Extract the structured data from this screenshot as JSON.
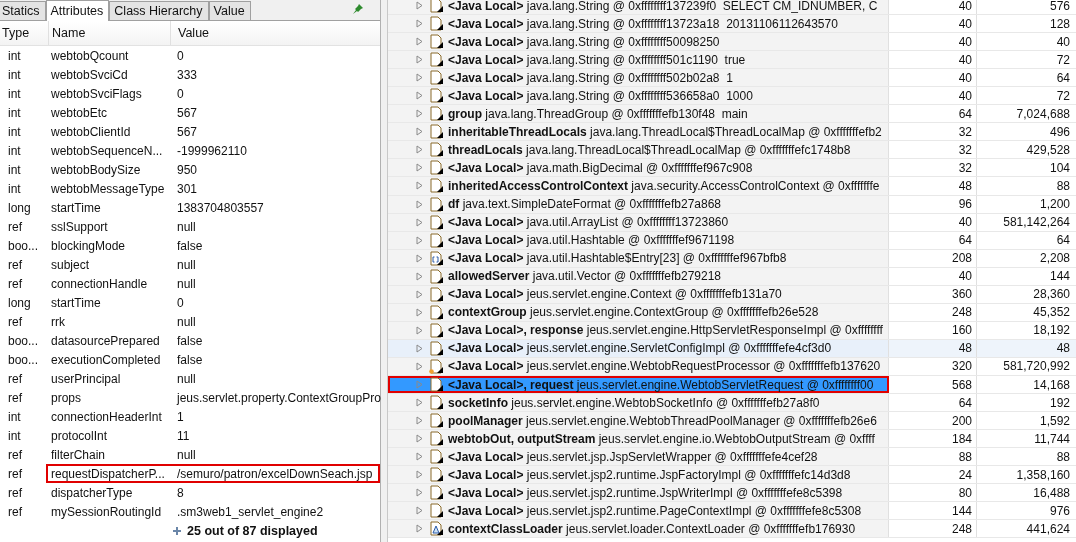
{
  "left_panel": {
    "tabs": [
      {
        "label": "Statics",
        "selected": false
      },
      {
        "label": "Attributes",
        "selected": true
      },
      {
        "label": "Class Hierarchy",
        "selected": false
      },
      {
        "label": "Value",
        "selected": false
      }
    ],
    "columns": [
      "Type",
      "Name",
      "Value"
    ],
    "rows": [
      {
        "type": "int",
        "name": "webtobQcount",
        "value": "0",
        "highlighted": false
      },
      {
        "type": "int",
        "name": "webtobSvciCd",
        "value": "333",
        "highlighted": false
      },
      {
        "type": "int",
        "name": "webtobSvciFlags",
        "value": "0",
        "highlighted": false
      },
      {
        "type": "int",
        "name": "webtobEtc",
        "value": "567",
        "highlighted": false
      },
      {
        "type": "int",
        "name": "webtobClientId",
        "value": "567",
        "highlighted": false
      },
      {
        "type": "int",
        "name": "webtobSequenceN...",
        "value": "-1999962110",
        "highlighted": false
      },
      {
        "type": "int",
        "name": "webtobBodySize",
        "value": "950",
        "highlighted": false
      },
      {
        "type": "int",
        "name": "webtobMessageType",
        "value": "301",
        "highlighted": false
      },
      {
        "type": "long",
        "name": "startTime",
        "value": "1383704803557",
        "highlighted": false
      },
      {
        "type": "ref",
        "name": "sslSupport",
        "value": "null",
        "highlighted": false
      },
      {
        "type": "boo...",
        "name": "blockingMode",
        "value": "false",
        "highlighted": false
      },
      {
        "type": "ref",
        "name": "subject",
        "value": "null",
        "highlighted": false
      },
      {
        "type": "ref",
        "name": "connectionHandle",
        "value": "null",
        "highlighted": false
      },
      {
        "type": "long",
        "name": "startTime",
        "value": "0",
        "highlighted": false
      },
      {
        "type": "ref",
        "name": "rrk",
        "value": "null",
        "highlighted": false
      },
      {
        "type": "boo...",
        "name": "datasourcePrepared",
        "value": "false",
        "highlighted": false
      },
      {
        "type": "boo...",
        "name": "executionCompleted",
        "value": "false",
        "highlighted": false
      },
      {
        "type": "ref",
        "name": "userPrincipal",
        "value": "null",
        "highlighted": false
      },
      {
        "type": "ref",
        "name": "props",
        "value": "jeus.servlet.property.ContextGroupPro",
        "highlighted": false
      },
      {
        "type": "int",
        "name": "connectionHeaderInt",
        "value": "1",
        "highlighted": false
      },
      {
        "type": "int",
        "name": "protocolInt",
        "value": "11",
        "highlighted": false
      },
      {
        "type": "ref",
        "name": "filterChain",
        "value": "null",
        "highlighted": false
      },
      {
        "type": "ref",
        "name": "requestDispatcherP...",
        "value": "/semuro/patron/excelDownSeach.jsp",
        "highlighted": true
      },
      {
        "type": "ref",
        "name": "dispatcherType",
        "value": "8",
        "highlighted": false
      },
      {
        "type": "ref",
        "name": "mySessionRoutingId",
        "value": ".sm3web1_servlet_engine2",
        "highlighted": false
      }
    ],
    "footer": "25 out of 87 displayed"
  },
  "tree": {
    "rows": [
      {
        "kind": "object",
        "text": "**<Java Local>** java.lang.String @ 0xffffffff137239f0  SELECT CM_IDNUMBER, C",
        "shallow": "40",
        "retained": "576",
        "selected": false,
        "highlighted": false,
        "hovered": false
      },
      {
        "kind": "object",
        "text": "**<Java Local>** java.lang.String @ 0xffffffff13723a18  20131106112643570",
        "shallow": "40",
        "retained": "128",
        "selected": false,
        "highlighted": false,
        "hovered": false
      },
      {
        "kind": "object",
        "text": "**<Java Local>** java.lang.String @ 0xffffffff50098250",
        "shallow": "40",
        "retained": "40",
        "selected": false,
        "highlighted": false,
        "hovered": false
      },
      {
        "kind": "object",
        "text": "**<Java Local>** java.lang.String @ 0xffffffff501c1190  true",
        "shallow": "40",
        "retained": "72",
        "selected": false,
        "highlighted": false,
        "hovered": false
      },
      {
        "kind": "object",
        "text": "**<Java Local>** java.lang.String @ 0xffffffff502b02a8  1",
        "shallow": "40",
        "retained": "64",
        "selected": false,
        "highlighted": false,
        "hovered": false
      },
      {
        "kind": "object",
        "text": "**<Java Local>** java.lang.String @ 0xffffffff536658a0  1000",
        "shallow": "40",
        "retained": "72",
        "selected": false,
        "highlighted": false,
        "hovered": false
      },
      {
        "kind": "object",
        "text": "**group** java.lang.ThreadGroup @ 0xfffffffefb130f48  main",
        "shallow": "64",
        "retained": "7,024,688",
        "selected": false,
        "highlighted": false,
        "hovered": false
      },
      {
        "kind": "object",
        "text": "**inheritableThreadLocals** java.lang.ThreadLocal$ThreadLocalMap @ 0xfffffffefb2",
        "shallow": "32",
        "retained": "496",
        "selected": false,
        "highlighted": false,
        "hovered": false
      },
      {
        "kind": "object",
        "text": "**threadLocals** java.lang.ThreadLocal$ThreadLocalMap @ 0xfffffffefc1748b8",
        "shallow": "32",
        "retained": "429,528",
        "selected": false,
        "highlighted": false,
        "hovered": false
      },
      {
        "kind": "object",
        "text": "**<Java Local>** java.math.BigDecimal @ 0xfffffffef967c908",
        "shallow": "32",
        "retained": "104",
        "selected": false,
        "highlighted": false,
        "hovered": false
      },
      {
        "kind": "object",
        "text": "**inheritedAccessControlContext** java.security.AccessControlContext @ 0xfffffffe",
        "shallow": "48",
        "retained": "88",
        "selected": false,
        "highlighted": false,
        "hovered": false
      },
      {
        "kind": "object",
        "text": "**df** java.text.SimpleDateFormat @ 0xfffffffefb27a868",
        "shallow": "96",
        "retained": "1,200",
        "selected": false,
        "highlighted": false,
        "hovered": false
      },
      {
        "kind": "object",
        "text": "**<Java Local>** java.util.ArrayList @ 0xffffffff13723860",
        "shallow": "40",
        "retained": "581,142,264",
        "selected": false,
        "highlighted": false,
        "hovered": false
      },
      {
        "kind": "object",
        "text": "**<Java Local>** java.util.Hashtable @ 0xfffffffef9671198",
        "shallow": "64",
        "retained": "64",
        "selected": false,
        "highlighted": false,
        "hovered": false
      },
      {
        "kind": "array",
        "text": "**<Java Local>** java.util.Hashtable$Entry[23] @ 0xfffffffef967bfb8",
        "shallow": "208",
        "retained": "2,208",
        "selected": false,
        "highlighted": false,
        "hovered": false
      },
      {
        "kind": "object",
        "text": "**allowedServer** java.util.Vector @ 0xfffffffefb279218",
        "shallow": "40",
        "retained": "144",
        "selected": false,
        "highlighted": false,
        "hovered": false
      },
      {
        "kind": "object",
        "text": "**<Java Local>** jeus.servlet.engine.Context @ 0xfffffffefb131a70",
        "shallow": "360",
        "retained": "28,360",
        "selected": false,
        "highlighted": false,
        "hovered": false
      },
      {
        "kind": "object",
        "text": "**contextGroup** jeus.servlet.engine.ContextGroup @ 0xfffffffefb26e528",
        "shallow": "248",
        "retained": "45,352",
        "selected": false,
        "highlighted": false,
        "hovered": false
      },
      {
        "kind": "object",
        "text": "**<Java Local>, response** jeus.servlet.engine.HttpServletResponseImpl @ 0xffffffff",
        "shallow": "160",
        "retained": "18,192",
        "selected": false,
        "highlighted": false,
        "hovered": false
      },
      {
        "kind": "object",
        "text": "**<Java Local>** jeus.servlet.engine.ServletConfigImpl @ 0xfffffffefe4cf3d0",
        "shallow": "48",
        "retained": "48",
        "selected": false,
        "highlighted": false,
        "hovered": true
      },
      {
        "kind": "root_object",
        "text": "**<Java Local>** jeus.servlet.engine.WebtobRequestProcessor @ 0xfffffffefb137620",
        "shallow": "320",
        "retained": "581,720,992",
        "selected": false,
        "highlighted": false,
        "hovered": false
      },
      {
        "kind": "object",
        "text": "**<Java Local>, request** jeus.servlet.engine.WebtobServletRequest @ 0xffffffff00",
        "shallow": "568",
        "retained": "14,168",
        "selected": true,
        "highlighted": true,
        "hovered": false
      },
      {
        "kind": "object",
        "text": "**socketInfo** jeus.servlet.engine.WebtobSocketInfo @ 0xfffffffefb27a8f0",
        "shallow": "64",
        "retained": "192",
        "selected": false,
        "highlighted": false,
        "hovered": false
      },
      {
        "kind": "object",
        "text": "**poolManager** jeus.servlet.engine.WebtobThreadPoolManager @ 0xfffffffefb26e6",
        "shallow": "200",
        "retained": "1,592",
        "selected": false,
        "highlighted": false,
        "hovered": false
      },
      {
        "kind": "object",
        "text": "**webtobOut, outputStream** jeus.servlet.engine.io.WebtobOutputStream @ 0xffff",
        "shallow": "184",
        "retained": "11,744",
        "selected": false,
        "highlighted": false,
        "hovered": false
      },
      {
        "kind": "object",
        "text": "**<Java Local>** jeus.servlet.jsp.JspServletWrapper @ 0xfffffffefe4cef28",
        "shallow": "88",
        "retained": "88",
        "selected": false,
        "highlighted": false,
        "hovered": false
      },
      {
        "kind": "object",
        "text": "**<Java Local>** jeus.servlet.jsp2.runtime.JspFactoryImpl @ 0xfffffffefc14d3d8",
        "shallow": "24",
        "retained": "1,358,160",
        "selected": false,
        "highlighted": false,
        "hovered": false
      },
      {
        "kind": "object",
        "text": "**<Java Local>** jeus.servlet.jsp2.runtime.JspWriterImpl @ 0xfffffffefe8c5398",
        "shallow": "80",
        "retained": "16,488",
        "selected": false,
        "highlighted": false,
        "hovered": false
      },
      {
        "kind": "object",
        "text": "**<Java Local>** jeus.servlet.jsp2.runtime.PageContextImpl @ 0xfffffffefe8c5308",
        "shallow": "144",
        "retained": "976",
        "selected": false,
        "highlighted": false,
        "hovered": false
      },
      {
        "kind": "classloader",
        "text": "**contextClassLoader** jeus.servlet.loader.ContextLoader @ 0xfffffffefb176930",
        "shallow": "248",
        "retained": "441,624",
        "selected": false,
        "highlighted": false,
        "hovered": false
      }
    ]
  }
}
